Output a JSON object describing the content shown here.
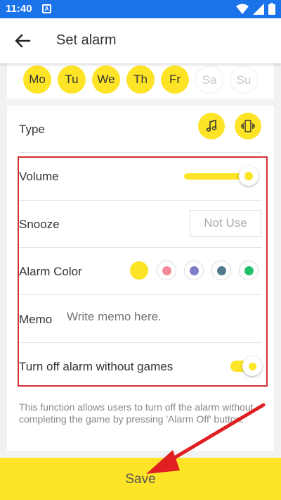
{
  "status_bar": {
    "time": "11:40",
    "notification_letter": "A"
  },
  "app_bar": {
    "title": "Set alarm",
    "back_icon": "back-arrow-icon"
  },
  "days": [
    {
      "label": "Mo",
      "selected": true
    },
    {
      "label": "Tu",
      "selected": true
    },
    {
      "label": "We",
      "selected": true
    },
    {
      "label": "Th",
      "selected": true
    },
    {
      "label": "Fr",
      "selected": true
    },
    {
      "label": "Sa",
      "selected": false
    },
    {
      "label": "Su",
      "selected": false
    }
  ],
  "settings": {
    "type_label": "Type",
    "type_icons": [
      "music-note-icon",
      "vibrate-icon"
    ],
    "volume_label": "Volume",
    "volume_level": 1.0,
    "snooze_label": "Snooze",
    "snooze_value": "Not Use",
    "alarm_color_label": "Alarm Color",
    "alarm_colors": [
      "#fde426",
      "#f28b96",
      "#7e7ec8",
      "#537a8c",
      "#22c06b"
    ],
    "selected_color": "#fde426",
    "memo_label": "Memo",
    "memo_placeholder": "Write memo here.",
    "turn_off_label": "Turn off alarm without games",
    "turn_off_enabled": true,
    "help_text": "This function allows users to turn off the alarm without completing the game by pressing 'Alarm Off' button."
  },
  "save_label": "Save",
  "accent_color": "#fde426",
  "annotation_color": "#d32f2f"
}
